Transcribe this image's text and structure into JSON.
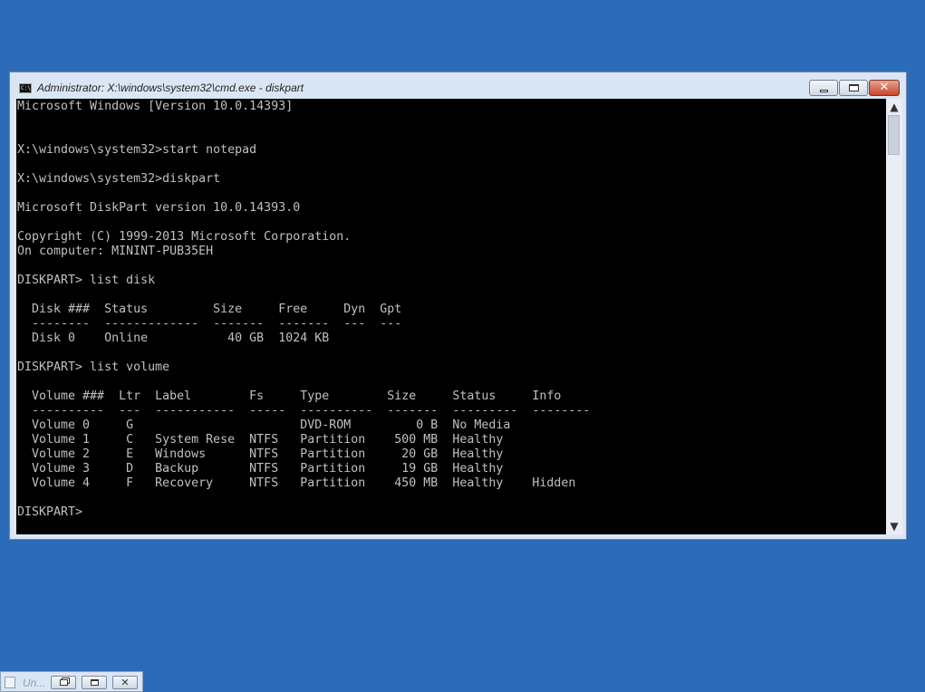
{
  "window": {
    "title": "Administrator: X:\\windows\\system32\\cmd.exe - diskpart",
    "icon": "console-icon",
    "buttons": {
      "minimize": "minimize-icon",
      "maximize": "maximize-icon",
      "close": "close-icon"
    }
  },
  "console": {
    "colors": {
      "background": "#000000",
      "text": "#c0c0c0"
    },
    "lines": [
      "Microsoft Windows [Version 10.0.14393]",
      "",
      "",
      "X:\\windows\\system32>start notepad",
      "",
      "X:\\windows\\system32>diskpart",
      "",
      "Microsoft DiskPart version 10.0.14393.0",
      "",
      "Copyright (C) 1999-2013 Microsoft Corporation.",
      "On computer: MININT-PUB35EH",
      "",
      "DISKPART> list disk",
      "",
      "  Disk ###  Status         Size     Free     Dyn  Gpt",
      "  --------  -------------  -------  -------  ---  ---",
      "  Disk 0    Online           40 GB  1024 KB",
      "",
      "DISKPART> list volume",
      "",
      "  Volume ###  Ltr  Label        Fs     Type        Size     Status     Info",
      "  ----------  ---  -----------  -----  ----------  -------  ---------  --------",
      "  Volume 0     G                       DVD-ROM         0 B  No Media",
      "  Volume 1     C   System Rese  NTFS   Partition    500 MB  Healthy",
      "  Volume 2     E   Windows      NTFS   Partition     20 GB  Healthy",
      "  Volume 3     D   Backup       NTFS   Partition     19 GB  Healthy",
      "  Volume 4     F   Recovery     NTFS   Partition    450 MB  Healthy    Hidden",
      "",
      "DISKPART> "
    ]
  },
  "scrollbar": {
    "up_icon": "▲",
    "down_icon": "▼"
  },
  "minimized_window": {
    "title": "Un...",
    "icon": "notepad-icon",
    "buttons": {
      "restore": "restore-icon",
      "maximize": "maximize-icon",
      "close": "close-icon"
    },
    "close_glyph": "✕"
  },
  "desktop": {
    "background": "#2c6bb7"
  }
}
